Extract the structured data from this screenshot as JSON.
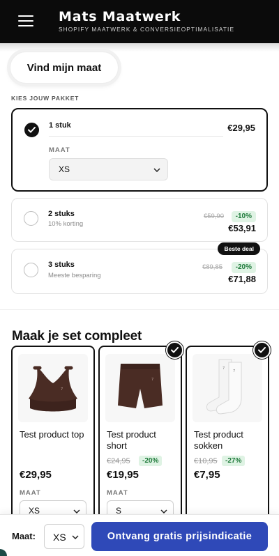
{
  "header": {
    "brand": "Mats Maatwerk",
    "tagline": "SHOPIFY MAATWERK & CONVERSIEOPTIMALISATIE",
    "menu_icon": "hamburger-menu-icon"
  },
  "size_finder": {
    "label": "Vind mijn maat"
  },
  "packages": {
    "section_label": "KIES JOUW PAKKET",
    "items": [
      {
        "title": "1 stuk",
        "subtitle": "",
        "price": "€29,95",
        "selected": true,
        "size_label": "MAAT",
        "size_value": "XS"
      },
      {
        "title": "2 stuks",
        "subtitle": "10% korting",
        "old_price": "€59,90",
        "discount": "-10%",
        "price": "€53,91",
        "selected": false
      },
      {
        "title": "3 stuks",
        "subtitle": "Meeste besparing",
        "old_price": "€89,85",
        "discount": "-20%",
        "price": "€71,88",
        "selected": false,
        "badge": "Beste deal"
      }
    ]
  },
  "bundle": {
    "title": "Maak je set compleet",
    "products": [
      {
        "name": "Test product top",
        "price": "€29,95",
        "size_label": "MAAT",
        "size_value": "XS",
        "checked": false,
        "image": "sports-bra-image"
      },
      {
        "name": "Test product short",
        "old_price": "€24,95",
        "discount": "-20%",
        "price": "€19,95",
        "size_label": "MAAT",
        "size_value": "S",
        "checked": true,
        "image": "shorts-image"
      },
      {
        "name": "Test product sokken",
        "old_price": "€10,95",
        "discount": "-27%",
        "price": "€7,95",
        "checked": true,
        "image": "socks-image"
      }
    ]
  },
  "sticky_bar": {
    "size_label": "Maat:",
    "size_value": "XS",
    "cta_label": "Ontvang gratis prijsindicatie"
  },
  "colors": {
    "header_bg": "#0b0b0b",
    "cta_bg": "#2f49b8",
    "discount_bg": "#dff3e4",
    "discount_text": "#1f7a3b",
    "product_brown": "#4a2c24"
  }
}
